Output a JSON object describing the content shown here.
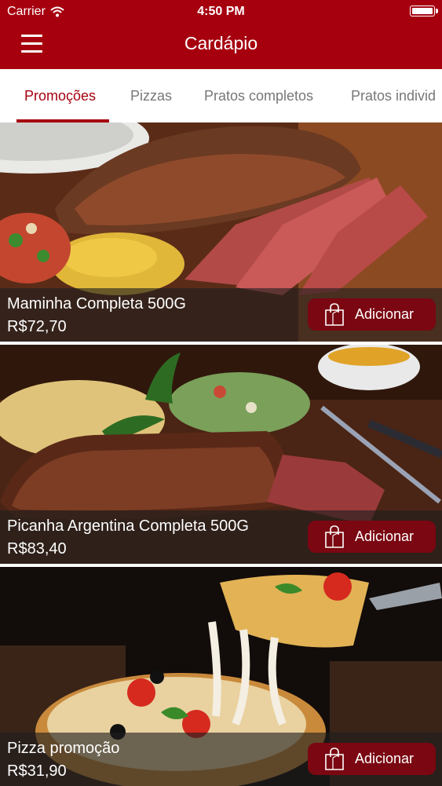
{
  "status_bar": {
    "carrier": "Carrier",
    "time": "4:50 PM"
  },
  "header": {
    "title": "Cardápio",
    "menu_icon": "hamburger-menu-icon"
  },
  "tabs": [
    {
      "label": "Promoções",
      "active": true
    },
    {
      "label": "Pizzas"
    },
    {
      "label": "Pratos completos"
    },
    {
      "label": "Pratos individ"
    }
  ],
  "items": [
    {
      "name": "Maminha Completa 500G",
      "price": "R$72,70",
      "button": "Adicionar"
    },
    {
      "name": "Picanha Argentina Completa 500G",
      "price": "R$83,40",
      "button": "Adicionar"
    },
    {
      "name": "Pizza promoção",
      "price": "R$31,90",
      "button": "Adicionar"
    }
  ],
  "colors": {
    "brand": "#a6000f",
    "button": "#7a0711",
    "tab_inactive": "#777777"
  }
}
